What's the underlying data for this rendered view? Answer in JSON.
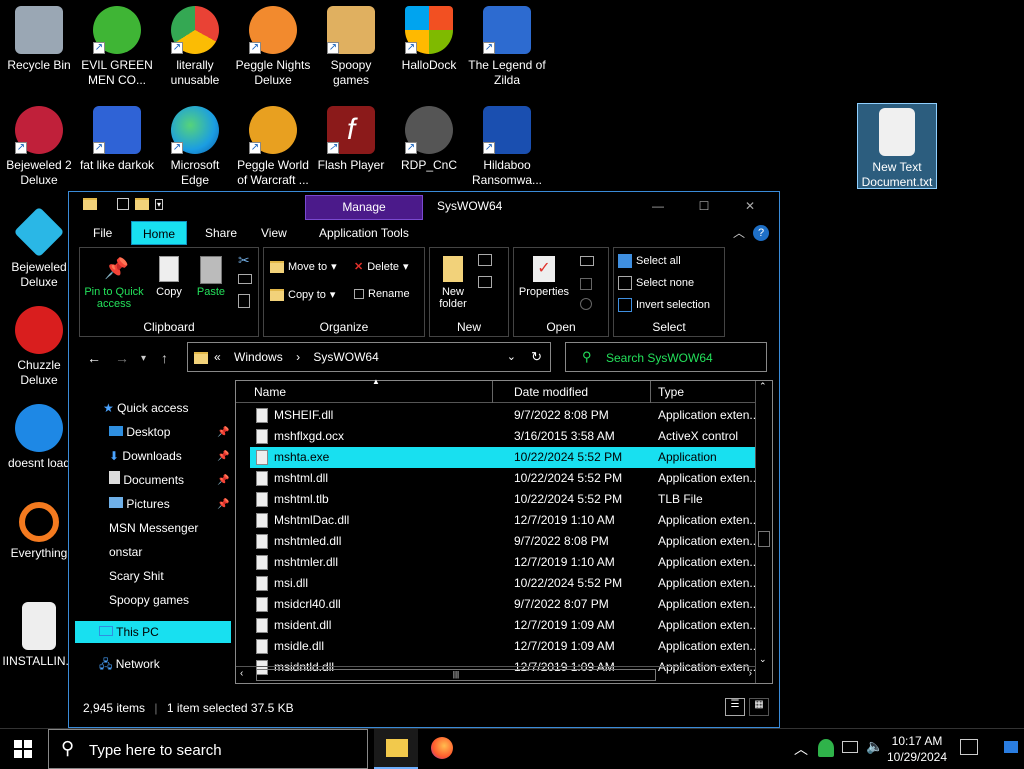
{
  "desktop": {
    "icons": [
      {
        "label": "Recycle Bin",
        "color": "#9aa7b4"
      },
      {
        "label": "EVIL GREEN MEN CO...",
        "color": "#3fb535"
      },
      {
        "label": "literally unusable",
        "color": "#e94235"
      },
      {
        "label": "Peggle Nights Deluxe",
        "color": "#f28a2e"
      },
      {
        "label": "Spoopy games",
        "color": "#e0b060"
      },
      {
        "label": "HalloDock",
        "color": "#f25022"
      },
      {
        "label": "The Legend of Zilda",
        "color": "#2d6bd0"
      },
      {
        "label": "Bejeweled 2 Deluxe",
        "color": "#c0203a"
      },
      {
        "label": "fat like darkok",
        "color": "#2f63d6"
      },
      {
        "label": "Microsoft Edge",
        "color": "#1b9de2"
      },
      {
        "label": "Peggle World of Warcraft ...",
        "color": "#e8a020"
      },
      {
        "label": "Flash Player",
        "color": "#8b1a1a"
      },
      {
        "label": "RDP_CnC",
        "color": "#555555"
      },
      {
        "label": "Hildaboo Ransomwa...",
        "color": "#1a4fb0"
      },
      {
        "label": "New Text Document.txt",
        "color": "#f0f0f0"
      },
      {
        "label": "Bejeweled Deluxe",
        "color": "#2ab7e6"
      },
      {
        "label": "Chuzzle Deluxe",
        "color": "#d91e1e"
      },
      {
        "label": "doesnt load",
        "color": "#1e88e5"
      },
      {
        "label": "Everything",
        "color": "#f47a1f"
      },
      {
        "label": "IINSTALLIN...",
        "color": "#eeeeee"
      }
    ]
  },
  "window": {
    "manage_label": "Manage",
    "title": "SysWOW64",
    "tabs": [
      "File",
      "Home",
      "Share",
      "View",
      "Application Tools"
    ],
    "ribbon": {
      "clipboard": {
        "pin": "Pin to Quick access",
        "copy": "Copy",
        "paste": "Paste",
        "label": "Clipboard"
      },
      "organize": {
        "move_to": "Move to",
        "copy_to": "Copy to",
        "delete": "Delete",
        "rename": "Rename",
        "label": "Organize"
      },
      "new": {
        "new_folder": "New folder",
        "label": "New"
      },
      "open": {
        "properties": "Properties",
        "label": "Open"
      },
      "select": {
        "select_all": "Select all",
        "select_none": "Select none",
        "invert": "Invert selection",
        "label": "Select"
      }
    },
    "address": {
      "crumbs": [
        "«",
        "Windows",
        "›",
        "SysWOW64"
      ]
    },
    "search_placeholder": "Search SysWOW64",
    "nav": {
      "quick_access": "Quick access",
      "items": [
        "Desktop",
        "Downloads",
        "Documents",
        "Pictures",
        "MSN Messenger",
        "onstar",
        "Scary Shit",
        "Spoopy games"
      ],
      "this_pc": "This PC",
      "network": "Network"
    },
    "columns": {
      "name": "Name",
      "date": "Date modified",
      "type": "Type"
    },
    "files": [
      {
        "name": "MSHEIF.dll",
        "date": "9/7/2022 8:08 PM",
        "type": "Application exten..."
      },
      {
        "name": "mshflxgd.ocx",
        "date": "3/16/2015 3:58 AM",
        "type": "ActiveX control"
      },
      {
        "name": "mshta.exe",
        "date": "10/22/2024 5:52 PM",
        "type": "Application"
      },
      {
        "name": "mshtml.dll",
        "date": "10/22/2024 5:52 PM",
        "type": "Application exten..."
      },
      {
        "name": "mshtml.tlb",
        "date": "10/22/2024 5:52 PM",
        "type": "TLB File"
      },
      {
        "name": "MshtmlDac.dll",
        "date": "12/7/2019 1:10 AM",
        "type": "Application exten..."
      },
      {
        "name": "mshtmled.dll",
        "date": "9/7/2022 8:08 PM",
        "type": "Application exten..."
      },
      {
        "name": "mshtmler.dll",
        "date": "12/7/2019 1:10 AM",
        "type": "Application exten..."
      },
      {
        "name": "msi.dll",
        "date": "10/22/2024 5:52 PM",
        "type": "Application exten..."
      },
      {
        "name": "msidcrl40.dll",
        "date": "9/7/2022 8:07 PM",
        "type": "Application exten..."
      },
      {
        "name": "msident.dll",
        "date": "12/7/2019 1:09 AM",
        "type": "Application exten..."
      },
      {
        "name": "msidle.dll",
        "date": "12/7/2019 1:09 AM",
        "type": "Application exten..."
      },
      {
        "name": "msidntld.dll",
        "date": "12/7/2019 1:09 AM",
        "type": "Application exten..."
      }
    ],
    "selected_index": 2,
    "status": {
      "count": "2,945 items",
      "selected": "1 item selected  37.5 KB"
    }
  },
  "taskbar": {
    "search_placeholder": "Type here to search",
    "time": "10:17 AM",
    "date": "10/29/2024"
  },
  "colors": {
    "accent": "#18e0f0",
    "green_text": "#23e05a",
    "manage": "#4b1a8a"
  }
}
